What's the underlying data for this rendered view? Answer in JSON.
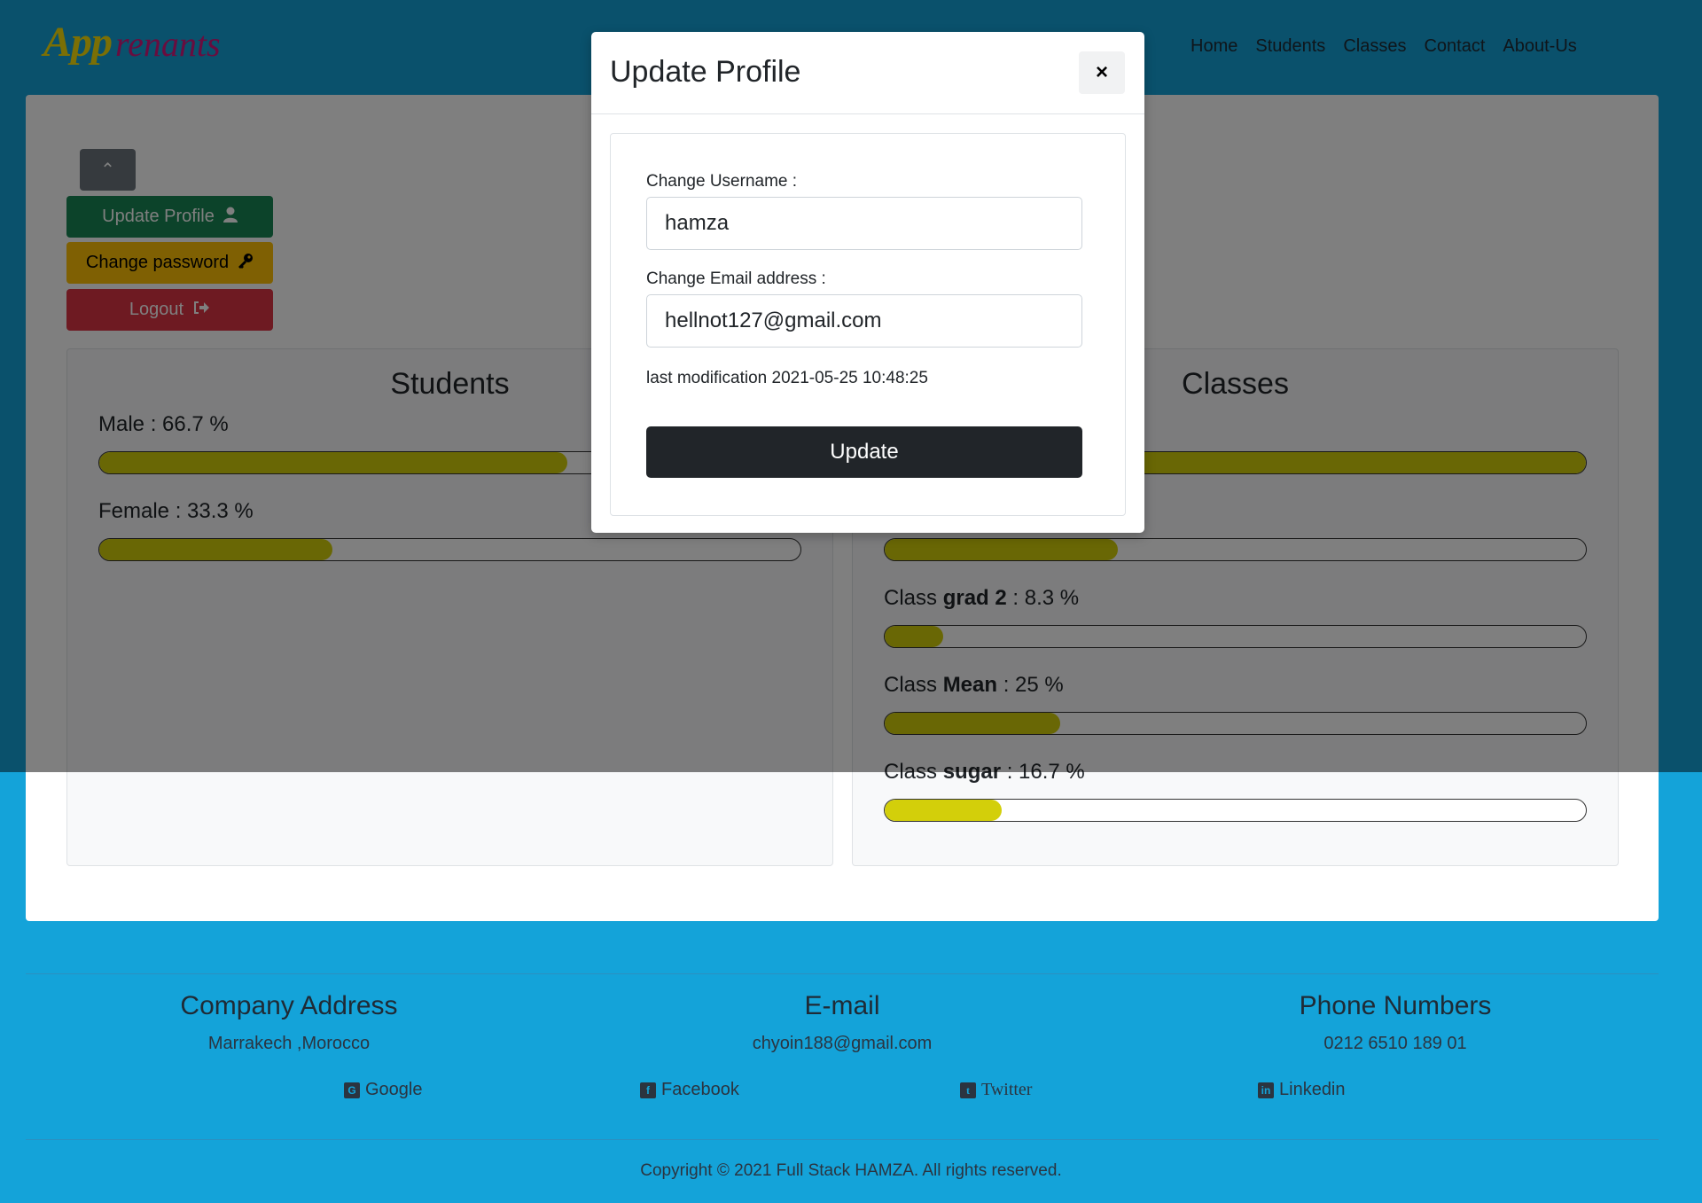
{
  "brand": {
    "part1": "App",
    "part2": "renants"
  },
  "nav": [
    "Home",
    "Students",
    "Classes",
    "Contact",
    "About-Us"
  ],
  "sidebar": {
    "update_profile": "Update Profile",
    "change_password": "Change password",
    "logout": "Logout"
  },
  "students": {
    "title": "Students",
    "items": [
      {
        "label": "Male : 66.7 %",
        "percent": 66.7
      },
      {
        "label": "Female : 33.3 %",
        "percent": 33.3
      }
    ]
  },
  "classes": {
    "title": "Classes",
    "items": [
      {
        "prefix": "Class ",
        "name": "grad 2",
        "suffix": " : 8.3 %",
        "percent": 8.3
      },
      {
        "prefix": "Class ",
        "name": "Mean",
        "suffix": " : 25 %",
        "percent": 25
      },
      {
        "prefix": "Class ",
        "name": "sugar",
        "suffix": " : 16.7 %",
        "percent": 16.7
      }
    ],
    "hidden_bars": [
      {
        "percent": 100
      },
      {
        "percent": 33.3
      }
    ]
  },
  "modal": {
    "title": "Update Profile",
    "close": "×",
    "username_label": "Change Username :",
    "username_value": "hamza",
    "email_label": "Change Email address :",
    "email_value": "hellnot127@gmail.com",
    "last_mod": "last modification 2021-05-25 10:48:25",
    "submit": "Update"
  },
  "footer": {
    "address_title": "Company Address",
    "address": "Marrakech ,Morocco",
    "email_title": "E-mail",
    "email": "chyoin188@gmail.com",
    "phone_title": "Phone Numbers",
    "phone": "0212 6510 189 01",
    "social": {
      "google": "Google",
      "facebook": "Facebook",
      "twitter": "Twitter",
      "linkedin": "Linkedin"
    },
    "copyright": "Copyright © 2021 Full Stack HAMZA. All rights reserved."
  },
  "colors": {
    "background": "#14a3d9",
    "bar_fill": "#d3cf0a",
    "update_btn": "#212529"
  }
}
